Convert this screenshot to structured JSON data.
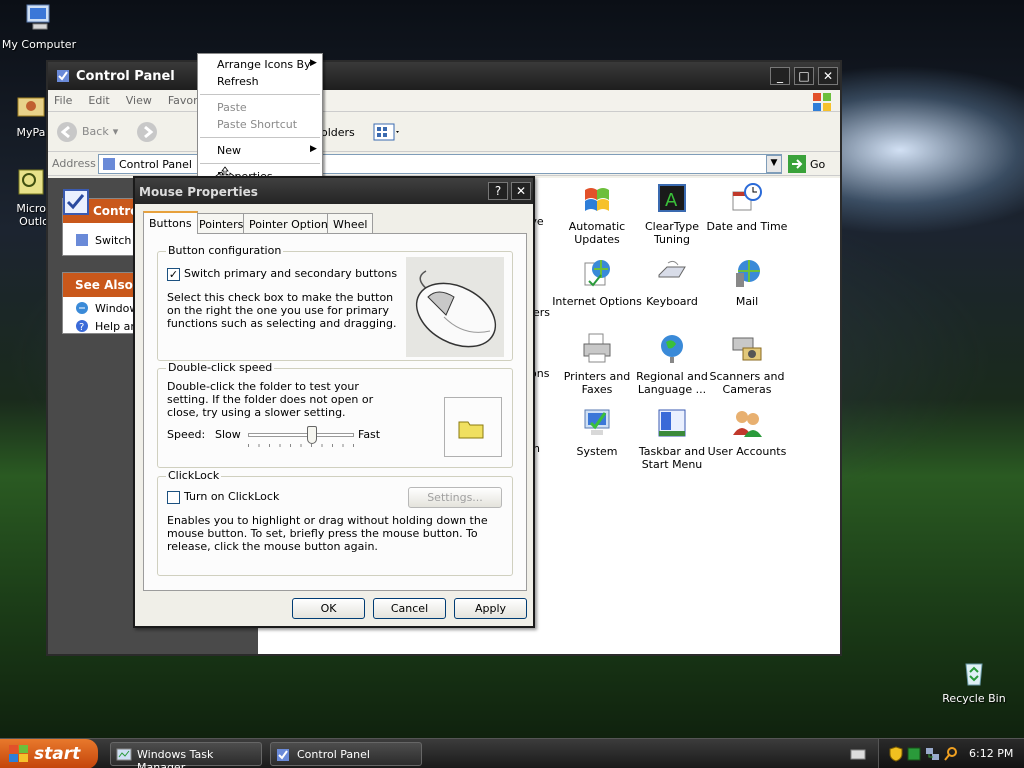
{
  "desktop": {
    "icons": [
      {
        "label": "My Computer",
        "icon": "my-computer-icon"
      },
      {
        "label": "MyPa",
        "icon": "folder-icon"
      },
      {
        "label": "Micros Outlo",
        "icon": "outlook-icon"
      },
      {
        "label": "Recycle Bin",
        "icon": "recycle-bin-icon"
      }
    ]
  },
  "control_panel": {
    "title": "Control Panel",
    "menu": [
      "File",
      "Edit",
      "View",
      "Favorit"
    ],
    "toolbar": {
      "back": "Back",
      "folders": "olders"
    },
    "address": {
      "label": "Address",
      "value": "Control Panel",
      "go": "Go"
    },
    "left": {
      "control_header": "Contro",
      "switch_label": "Switch",
      "see_also_header": "See Also",
      "see_also_items": [
        "Window",
        "Help an"
      ]
    },
    "items": [
      {
        "label": "tive"
      },
      {
        "label": "Automatic Updates"
      },
      {
        "label": "ClearType Tuning"
      },
      {
        "label": "Date and Time"
      },
      {
        "label": "Internet Options"
      },
      {
        "label": "Keyboard"
      },
      {
        "label": "Mail"
      },
      {
        "label": "ers"
      },
      {
        "label": "ions"
      },
      {
        "label": "Printers and Faxes"
      },
      {
        "label": "Regional and Language ..."
      },
      {
        "label": "Scanners and Cameras"
      },
      {
        "label": "n"
      },
      {
        "label": "System"
      },
      {
        "label": "Taskbar and Start Menu"
      },
      {
        "label": "User Accounts"
      }
    ]
  },
  "context_menu": {
    "items": [
      "Arrange Icons By",
      "Refresh",
      "Paste",
      "Paste Shortcut",
      "New",
      "Properties"
    ]
  },
  "mouse_dialog": {
    "title": "Mouse Properties",
    "tabs": [
      "Buttons",
      "Pointers",
      "Pointer Options",
      "Wheel"
    ],
    "button_config": {
      "legend": "Button configuration",
      "checkbox_label": "Switch primary and secondary buttons",
      "checked": true,
      "description": "Select this check box to make the button on the right the one you use for primary functions such as selecting and dragging."
    },
    "double_click": {
      "legend": "Double-click speed",
      "description": "Double-click the folder to test your setting. If the folder does not open or close, try using a slower setting.",
      "speed_label": "Speed:",
      "slow": "Slow",
      "fast": "Fast",
      "slider_level": 0.6
    },
    "clicklock": {
      "legend": "ClickLock",
      "checkbox_label": "Turn on ClickLock",
      "checked": false,
      "settings_button": "Settings...",
      "description": "Enables you to highlight or drag without holding down the mouse button. To set, briefly press the mouse button. To release, click the mouse button again."
    },
    "buttons": {
      "ok": "OK",
      "cancel": "Cancel",
      "apply": "Apply"
    }
  },
  "taskbar": {
    "start": "start",
    "tasks": [
      "Windows Task Manager",
      "Control Panel"
    ],
    "clock": "6:12 PM"
  }
}
